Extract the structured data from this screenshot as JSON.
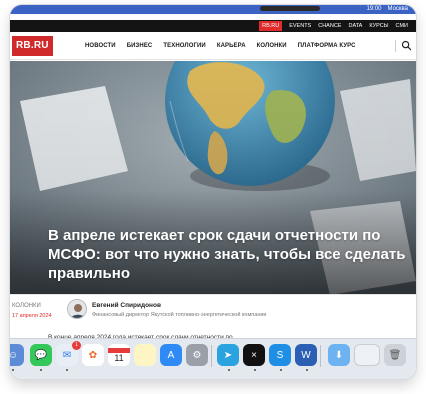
{
  "system": {
    "clock": "19:00",
    "city": "Москва"
  },
  "topstrip": {
    "items": [
      "RB.RU",
      "EVENTS",
      "CHANCE",
      "DATA",
      "КУРСЫ",
      "СМИ"
    ]
  },
  "header": {
    "logo": "RB.RU",
    "nav": [
      "НОВОСТИ",
      "БИЗНЕС",
      "ТЕХНОЛОГИИ",
      "КАРЬЕРА",
      "КОЛОНКИ",
      "ПЛАТФОРМА КУРС"
    ]
  },
  "article": {
    "headline": "В апреле истекает срок сдачи отчетности по МСФО: вот что нужно знать, чтобы все сделать правильно",
    "category": "КОЛОНКИ",
    "date": "17 апреля 2024",
    "author_name": "Евгений Спиридонов",
    "author_role": "Финансовый директор Якутской топливно-энергетической компании",
    "lead": "В конце апреля 2024 года истекает срок сдачи отчетности по"
  },
  "dock": {
    "calendar_day": "11",
    "mail_badge": "1"
  },
  "colors": {
    "accent": "#d12a2a",
    "menubar": "#3b63c4"
  }
}
